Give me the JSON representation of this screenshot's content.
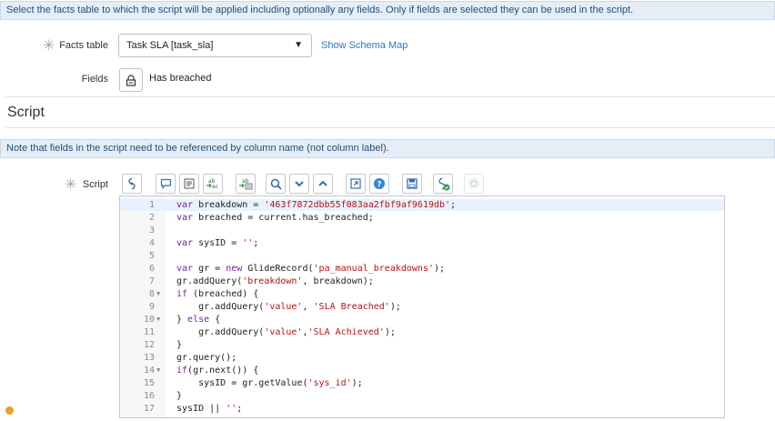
{
  "form": {
    "top_info": "Select the facts table to which the script will be applied including optionally any fields. Only if fields are selected they can be used in the script.",
    "facts_table": {
      "label": "Facts table",
      "value": "Task SLA [task_sla]",
      "link": "Show Schema Map"
    },
    "fields": {
      "label": "Fields",
      "value": "Has breached"
    }
  },
  "script_section": {
    "title": "Script",
    "info": "Note that fields in the script need to be referenced by column name (not column label).",
    "label": "Script",
    "toolbar": [
      {
        "name": "toggle-syntax-button",
        "icon": "syntax-toggle-icon"
      },
      {
        "name": "comment-button",
        "icon": "comment-bubble-icon"
      },
      {
        "name": "format-button",
        "icon": "format-lines-icon"
      },
      {
        "name": "replace-button",
        "icon": "replace-icon"
      },
      {
        "name": "replace-all-button",
        "icon": "replace-all-icon"
      },
      {
        "name": "search-button",
        "icon": "search-icon"
      },
      {
        "name": "find-next-button",
        "icon": "chevron-down-icon"
      },
      {
        "name": "find-previous-button",
        "icon": "chevron-up-icon"
      },
      {
        "name": "fullscreen-button",
        "icon": "expand-icon"
      },
      {
        "name": "help-button",
        "icon": "help-icon"
      },
      {
        "name": "save-button",
        "icon": "save-icon"
      },
      {
        "name": "script-debugger-button",
        "icon": "script-check-icon"
      },
      {
        "name": "disabled-tool-button",
        "icon": "gear-icon"
      }
    ],
    "code_lines": [
      {
        "num": "1",
        "fold": false,
        "text": "var breakdown = '463f7872dbb55f083aa2fbf9af9619db';"
      },
      {
        "num": "2",
        "fold": false,
        "text": "var breached = current.has_breached;"
      },
      {
        "num": "3",
        "fold": false,
        "text": ""
      },
      {
        "num": "4",
        "fold": false,
        "text": "var sysID = '';"
      },
      {
        "num": "5",
        "fold": false,
        "text": ""
      },
      {
        "num": "6",
        "fold": false,
        "text": "var gr = new GlideRecord('pa_manual_breakdowns');"
      },
      {
        "num": "7",
        "fold": false,
        "text": "gr.addQuery('breakdown', breakdown);"
      },
      {
        "num": "8",
        "fold": true,
        "text": "if (breached) {"
      },
      {
        "num": "9",
        "fold": false,
        "text": "    gr.addQuery('value', 'SLA Breached');"
      },
      {
        "num": "10",
        "fold": true,
        "text": "} else {"
      },
      {
        "num": "11",
        "fold": false,
        "text": "    gr.addQuery('value','SLA Achieved');"
      },
      {
        "num": "12",
        "fold": false,
        "text": "}"
      },
      {
        "num": "13",
        "fold": false,
        "text": "gr.query();"
      },
      {
        "num": "14",
        "fold": true,
        "text": "if(gr.next()) {"
      },
      {
        "num": "15",
        "fold": false,
        "text": "    sysID = gr.getValue('sys_id');"
      },
      {
        "num": "16",
        "fold": false,
        "text": "}"
      },
      {
        "num": "17",
        "fold": false,
        "text": "sysID || '';"
      }
    ],
    "warning_line": "17"
  },
  "colors": {
    "info_bg": "#e5eef7",
    "link": "#2f77c5",
    "toolbar_icon": "#2f6fb8",
    "warning": "#f0a01e"
  }
}
